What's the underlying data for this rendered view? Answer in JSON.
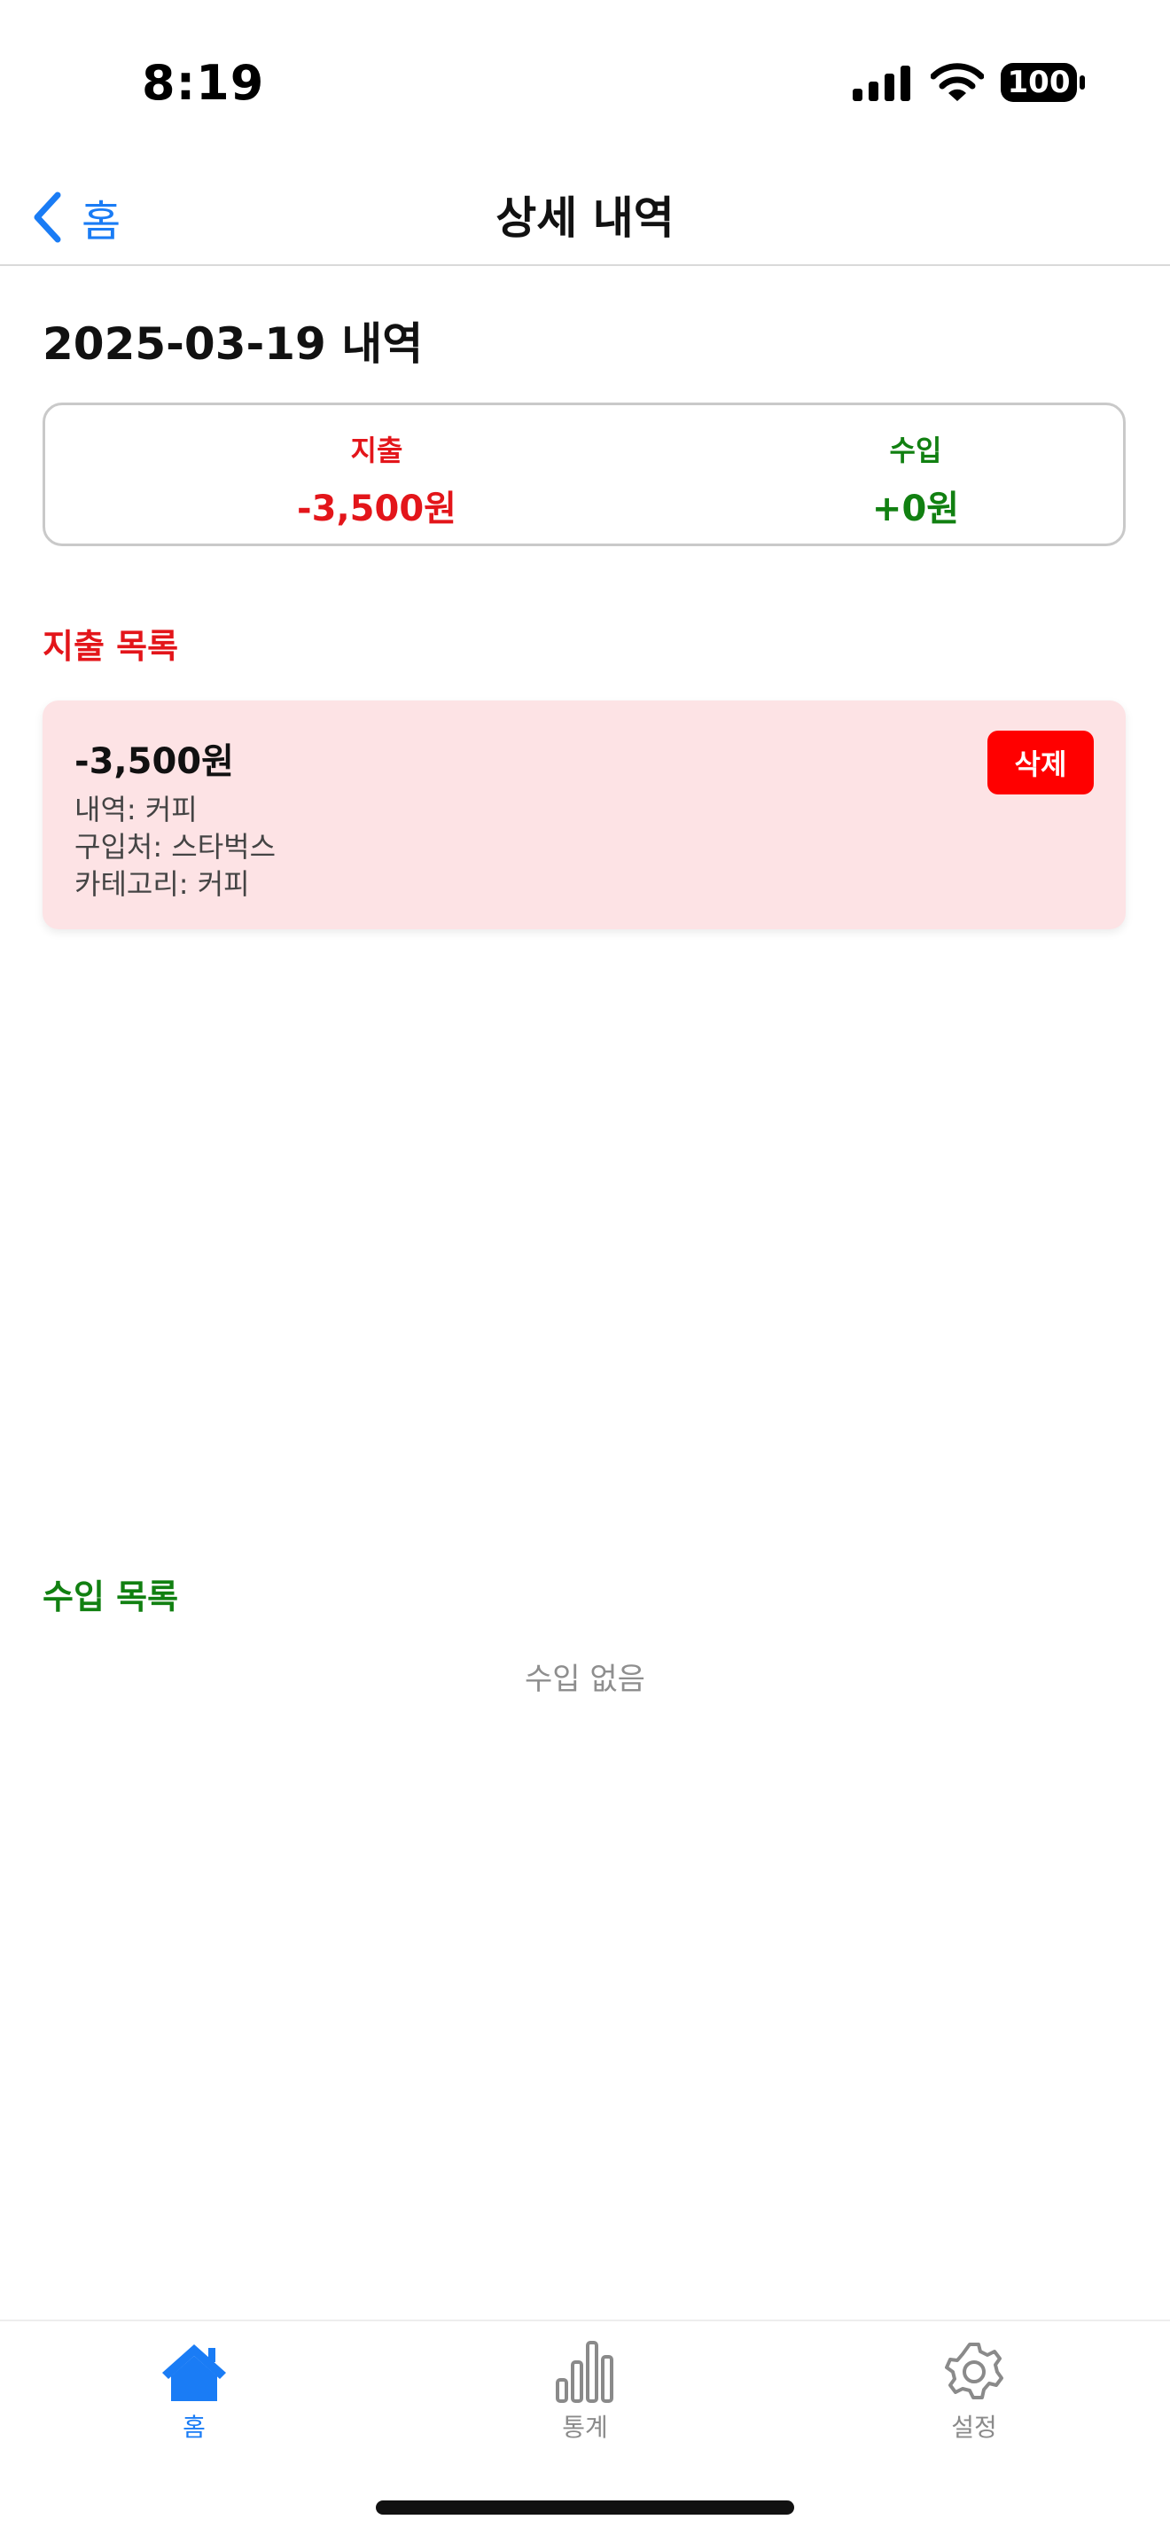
{
  "status_bar": {
    "time": "8:19",
    "battery": "100"
  },
  "nav": {
    "back_label": "홈",
    "title": "상세 내역"
  },
  "date_heading": "2025-03-19 내역",
  "summary": {
    "expense_label": "지출",
    "expense_value": "-3,500원",
    "income_label": "수입",
    "income_value": "+0원"
  },
  "expense_section": {
    "title": "지출 목록",
    "items": [
      {
        "amount": "-3,500원",
        "desc": "내역: 커피",
        "store": "구입처: 스타벅스",
        "category": "카테고리: 커피",
        "delete_label": "삭제"
      }
    ]
  },
  "income_section": {
    "title": "수입 목록",
    "empty_text": "수입 없음"
  },
  "tab_bar": {
    "tabs": [
      {
        "label": "홈",
        "icon": "house-icon",
        "active": true
      },
      {
        "label": "통계",
        "icon": "bar-chart-icon",
        "active": false
      },
      {
        "label": "설정",
        "icon": "gear-icon",
        "active": false
      }
    ]
  },
  "colors": {
    "accent": "#1a7cf5",
    "expense": "#e3151a",
    "income": "#118011",
    "card_bg": "#fde3e5",
    "delete": "#ff0000"
  }
}
